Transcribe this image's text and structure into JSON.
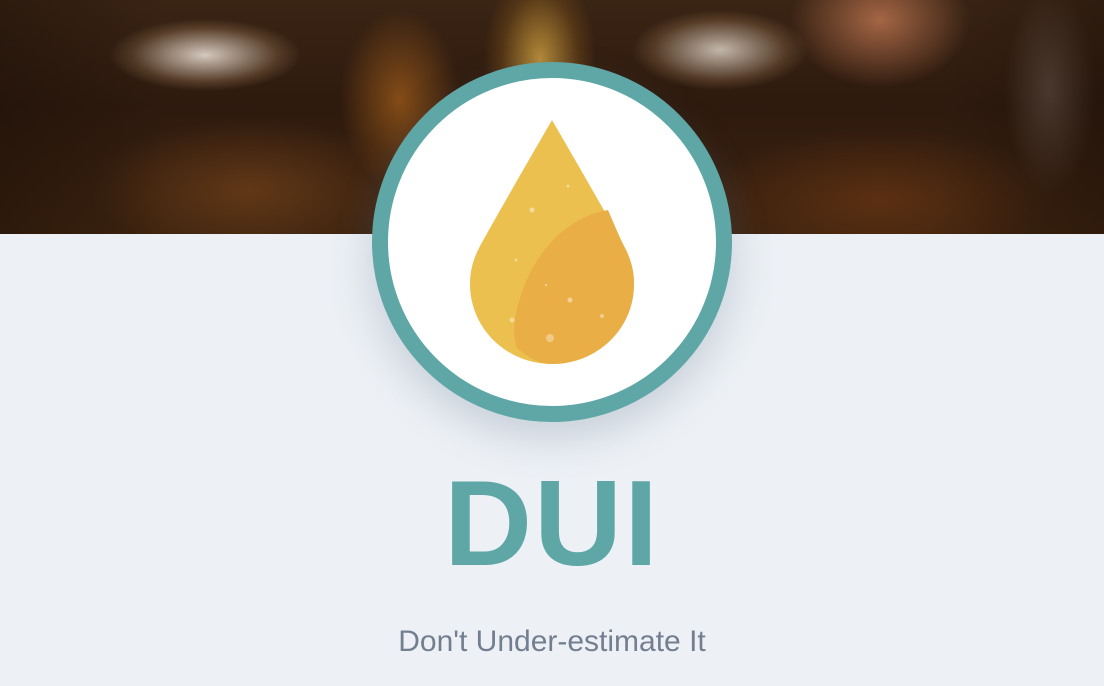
{
  "brand": {
    "name": "DUI",
    "tagline": "Don't Under-estimate It",
    "logo_icon": "oil-drop-icon"
  },
  "colors": {
    "accent": "#5fa7a7",
    "drop_light": "#ebc04f",
    "drop_dark": "#e9ae46",
    "background": "#edf1f6",
    "tagline_text": "#737f90"
  }
}
